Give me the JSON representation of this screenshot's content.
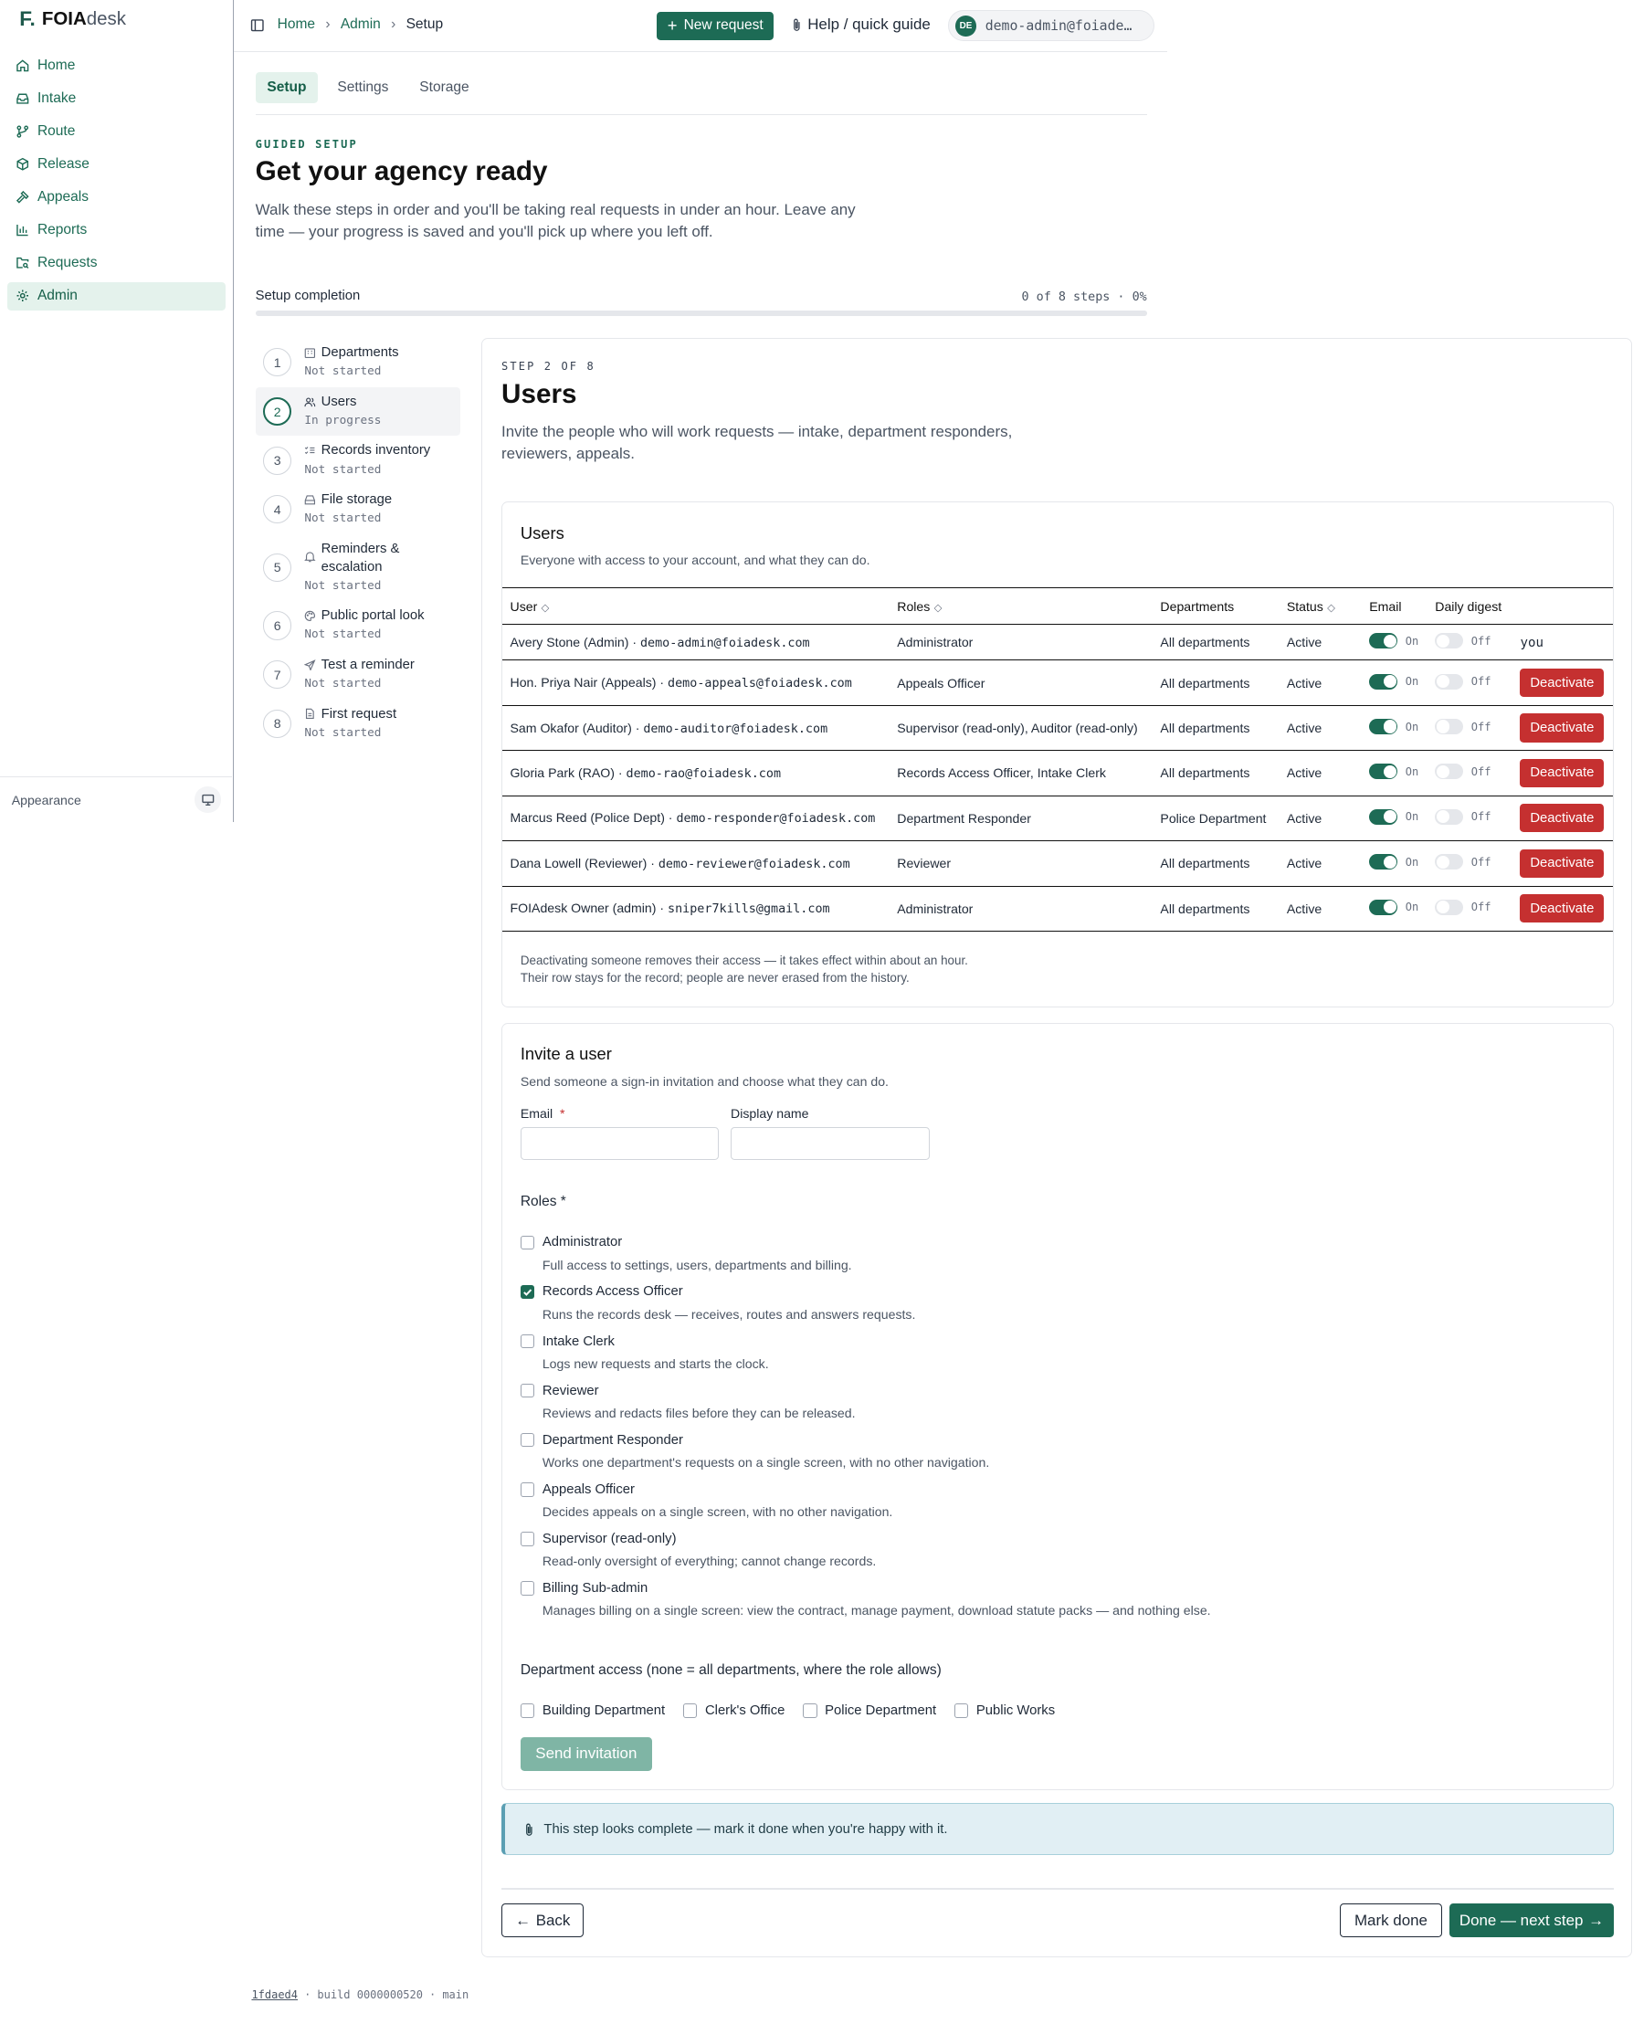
{
  "app": {
    "logo_mark": "F.",
    "name_bold": "FOIA",
    "name_light": "desk"
  },
  "sidebar": {
    "items": [
      {
        "label": "Home",
        "icon": "home-icon"
      },
      {
        "label": "Intake",
        "icon": "inbox-icon"
      },
      {
        "label": "Route",
        "icon": "route-icon"
      },
      {
        "label": "Release",
        "icon": "package-icon"
      },
      {
        "label": "Appeals",
        "icon": "gavel-icon"
      },
      {
        "label": "Reports",
        "icon": "bar-chart-icon"
      },
      {
        "label": "Requests",
        "icon": "folder-search-icon"
      },
      {
        "label": "Admin",
        "icon": "gear-icon",
        "active": true
      }
    ],
    "appearance_label": "Appearance"
  },
  "topbar": {
    "breadcrumb": [
      "Home",
      "Admin",
      "Setup"
    ],
    "new_request": "New request",
    "help": "Help / quick guide",
    "user_initials": "DE",
    "user_email": "demo-admin@foiade…"
  },
  "tabs": [
    {
      "label": "Setup",
      "active": true
    },
    {
      "label": "Settings"
    },
    {
      "label": "Storage"
    }
  ],
  "header": {
    "eyebrow": "GUIDED SETUP",
    "title": "Get your agency ready",
    "lede": "Walk these steps in order and you'll be taking real requests in under an hour. Leave any time — your progress is saved and you'll pick up where you left off."
  },
  "completion": {
    "label": "Setup completion",
    "count": "0 of 8 steps · 0%",
    "fraction": 0
  },
  "steps": [
    {
      "num": "1",
      "title": "Departments",
      "status": "Not started"
    },
    {
      "num": "2",
      "title": "Users",
      "status": "In progress",
      "active": true
    },
    {
      "num": "3",
      "title": "Records inventory",
      "status": "Not started"
    },
    {
      "num": "4",
      "title": "File storage",
      "status": "Not started"
    },
    {
      "num": "5",
      "title": "Reminders & escalation",
      "status": "Not started"
    },
    {
      "num": "6",
      "title": "Public portal look",
      "status": "Not started"
    },
    {
      "num": "7",
      "title": "Test a reminder",
      "status": "Not started"
    },
    {
      "num": "8",
      "title": "First request",
      "status": "Not started"
    }
  ],
  "step": {
    "eyebrow": "STEP 2 OF 8",
    "title": "Users",
    "desc": "Invite the people who will work requests — intake, department responders, reviewers, appeals."
  },
  "users_panel": {
    "title": "Users",
    "subtitle": "Everyone with access to your account, and what they can do.",
    "columns": [
      "User",
      "Roles",
      "Departments",
      "Status",
      "Email",
      "Daily digest"
    ],
    "on_label": "On",
    "off_label": "Off",
    "deactivate": "Deactivate",
    "you": "you",
    "rows": [
      {
        "name": "Avery Stone (Admin) · ",
        "email": "demo-admin@foiadesk.com",
        "roles": "Administrator",
        "departments": "All departments",
        "status": "Active",
        "self": true
      },
      {
        "name": "Hon. Priya Nair (Appeals) · ",
        "email": "demo-appeals@foiadesk.com",
        "roles": "Appeals Officer",
        "departments": "All departments",
        "status": "Active"
      },
      {
        "name": "Sam Okafor (Auditor) · ",
        "email": "demo-auditor@foiadesk.com",
        "roles": "Supervisor (read-only), Auditor (read-only)",
        "departments": "All departments",
        "status": "Active"
      },
      {
        "name": "Gloria Park (RAO) · ",
        "email": "demo-rao@foiadesk.com",
        "roles": "Records Access Officer, Intake Clerk",
        "departments": "All departments",
        "status": "Active"
      },
      {
        "name": "Marcus Reed (Police Dept) · ",
        "email": "demo-responder@foiadesk.com",
        "roles": "Department Responder",
        "departments": "Police Department",
        "status": "Active"
      },
      {
        "name": "Dana Lowell (Reviewer) · ",
        "email": "demo-reviewer@foiadesk.com",
        "roles": "Reviewer",
        "departments": "All departments",
        "status": "Active"
      },
      {
        "name": "FOIAdesk Owner (admin) · ",
        "email": "sniper7kills@gmail.com",
        "roles": "Administrator",
        "departments": "All departments",
        "status": "Active"
      }
    ],
    "note": "Deactivating someone removes their access — it takes effect within about an hour. Their row stays for the record; people are never erased from the history."
  },
  "invite": {
    "title": "Invite a user",
    "subtitle": "Send someone a sign-in invitation and choose what they can do.",
    "email_label": "Email",
    "required_mark": "*",
    "display_label": "Display name",
    "roles_label": "Roles *",
    "roles": [
      {
        "name": "Administrator",
        "desc": "Full access to settings, users, departments and billing.",
        "checked": false
      },
      {
        "name": "Records Access Officer",
        "desc": "Runs the records desk — receives, routes and answers requests.",
        "checked": true
      },
      {
        "name": "Intake Clerk",
        "desc": "Logs new requests and starts the clock.",
        "checked": false
      },
      {
        "name": "Reviewer",
        "desc": "Reviews and redacts files before they can be released.",
        "checked": false
      },
      {
        "name": "Department Responder",
        "desc": "Works one department's requests on a single screen, with no other navigation.",
        "checked": false
      },
      {
        "name": "Appeals Officer",
        "desc": "Decides appeals on a single screen, with no other navigation.",
        "checked": false
      },
      {
        "name": "Supervisor (read-only)",
        "desc": "Read-only oversight of everything; cannot change records.",
        "checked": false
      },
      {
        "name": "Billing Sub-admin",
        "desc": "Manages billing on a single screen: view the contract, manage payment, download statute packs — and nothing else.",
        "checked": false
      }
    ],
    "dept_label": "Department access (none = all departments, where the role allows)",
    "departments": [
      "Building Department",
      "Clerk's Office",
      "Police Department",
      "Public Works"
    ],
    "send": "Send invitation"
  },
  "callout": "This step looks complete — mark it done when you're happy with it.",
  "actions": {
    "back": "Back",
    "mark_done": "Mark done",
    "next": "Done — next step"
  },
  "footer": {
    "commit": "1fdaed4",
    "build": "build 0000000520",
    "branch": "main",
    "sep": "·"
  }
}
